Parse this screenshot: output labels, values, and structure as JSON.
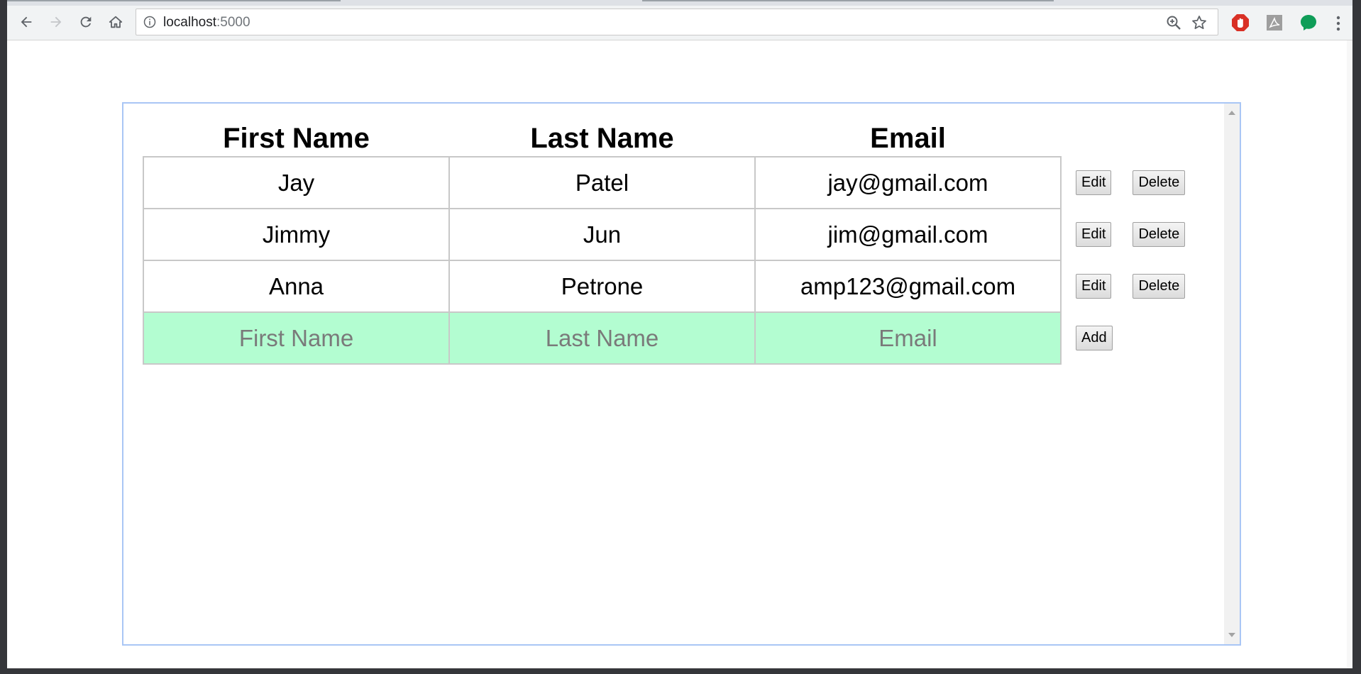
{
  "browser": {
    "url_host": "localhost",
    "url_port": ":5000",
    "icons": {
      "back": "arrow-left-icon",
      "forward": "arrow-right-icon",
      "reload": "reload-icon",
      "home": "home-icon",
      "info": "info-icon",
      "zoom": "zoom-icon",
      "bookmark": "star-icon",
      "menu": "kebab-menu-icon"
    },
    "extensions": [
      {
        "name": "ad-blocker-extension-icon",
        "color": "#d93025"
      },
      {
        "name": "pdf-extension-icon",
        "color": "#9e9e9e"
      },
      {
        "name": "chat-extension-icon",
        "color": "#0f9d58"
      }
    ]
  },
  "table": {
    "headers": [
      "First Name",
      "Last Name",
      "Email"
    ],
    "rows": [
      {
        "first": "Jay",
        "last": "Patel",
        "email": "jay@gmail.com"
      },
      {
        "first": "Jimmy",
        "last": "Jun",
        "email": "jim@gmail.com"
      },
      {
        "first": "Anna",
        "last": "Petrone",
        "email": "amp123@gmail.com"
      }
    ],
    "edit_label": "Edit",
    "delete_label": "Delete"
  },
  "new_entry": {
    "first_placeholder": "First Name",
    "last_placeholder": "Last Name",
    "email_placeholder": "Email",
    "add_label": "Add",
    "row_color": "#b3fdd1"
  },
  "colors": {
    "frame_border": "#a9c6f5",
    "cell_border": "#c8c8c8"
  }
}
